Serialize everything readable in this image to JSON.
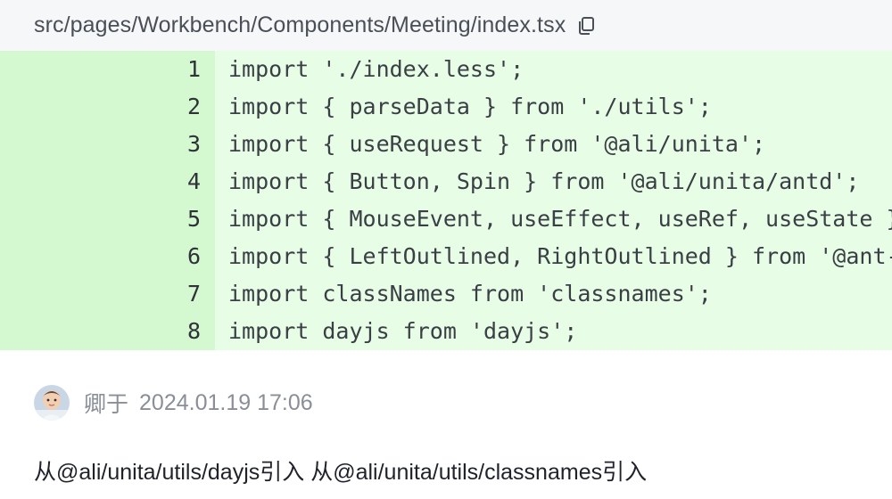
{
  "file": {
    "path": "src/pages/Workbench/Components/Meeting/index.tsx",
    "copy_icon": "copy-icon"
  },
  "code_lines": [
    {
      "num": "1",
      "text": "import './index.less';"
    },
    {
      "num": "2",
      "text": "import { parseData } from './utils';"
    },
    {
      "num": "3",
      "text": "import { useRequest } from '@ali/unita';"
    },
    {
      "num": "4",
      "text": "import { Button, Spin } from '@ali/unita/antd';"
    },
    {
      "num": "5",
      "text": "import { MouseEvent, useEffect, useRef, useState } from 'react';"
    },
    {
      "num": "6",
      "text": "import { LeftOutlined, RightOutlined } from '@ant-design/icons';"
    },
    {
      "num": "7",
      "text": "import classNames from 'classnames';"
    },
    {
      "num": "8",
      "text": "import dayjs from 'dayjs';"
    }
  ],
  "comment": {
    "author": "卿于",
    "timestamp": "2024.01.19 17:06",
    "body": "从@ali/unita/utils/dayjs引入 从@ali/unita/utils/classnames引入",
    "avatar_icon": "avatar"
  },
  "colors": {
    "added_line_bg": "#e8fde6",
    "added_gutter_bg": "#d4f8cf",
    "header_bg": "#f6f7f9"
  }
}
